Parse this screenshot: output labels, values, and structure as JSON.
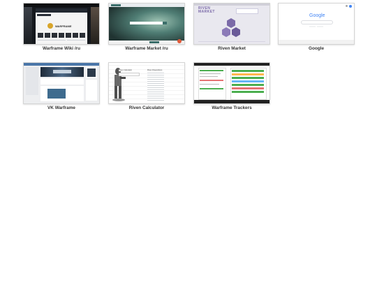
{
  "tiles": [
    {
      "label": "Warframe Wiki /ru",
      "logo_text": "WARFRAME"
    },
    {
      "label": "Warframe Market /ru"
    },
    {
      "label": "Riven Market",
      "logo_line1": "RIVEN",
      "logo_line2": "MARKET"
    },
    {
      "label": "Google",
      "logo_text": "Google"
    },
    {
      "label": "VK Warframe"
    },
    {
      "label": "Riven Calculator",
      "col1_title": "Riven Calculator",
      "col2_title": "Riven Dispositions"
    },
    {
      "label": "Warframe Trackers"
    }
  ],
  "colors": {
    "caption": "#333333",
    "thumb_border": "#d4d4d4",
    "wiki_dark": "#1a1d22",
    "market_teal": "#3b6e6a",
    "riven_purple": "#7b6aa8",
    "vk_blue": "#4a76a8",
    "tracker_green": "#4caf50"
  }
}
